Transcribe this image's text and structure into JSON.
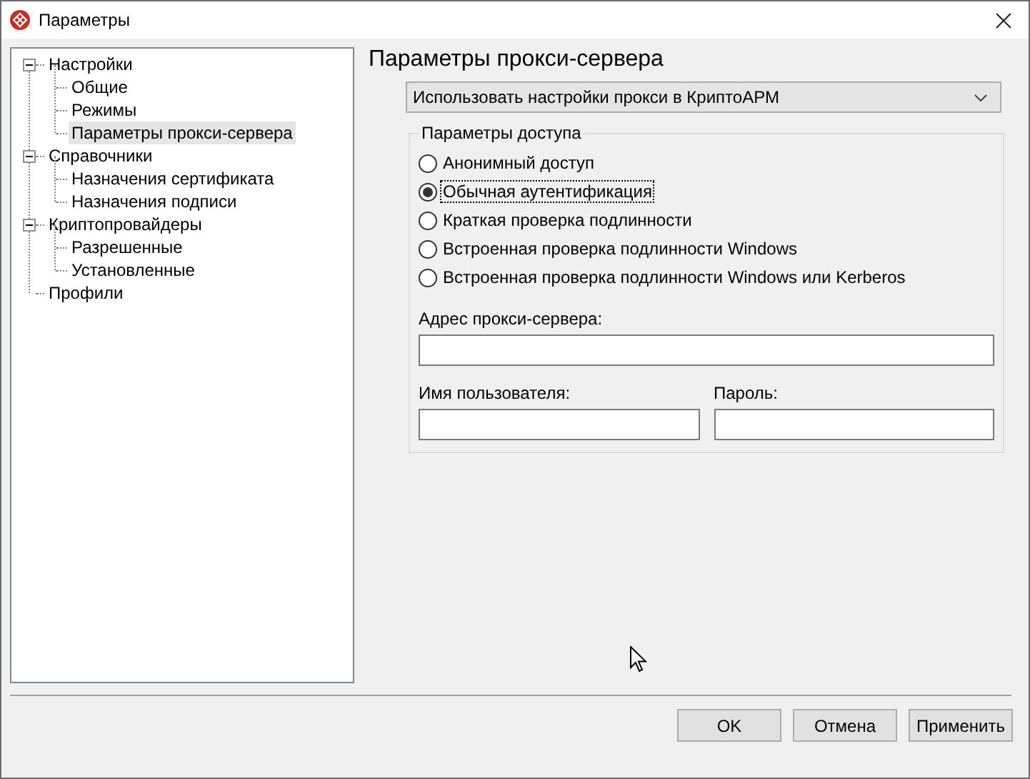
{
  "window": {
    "title": "Параметры"
  },
  "tree": [
    {
      "label": "Настройки",
      "expanded": true,
      "selected": false,
      "children": [
        {
          "label": "Общие",
          "selected": false
        },
        {
          "label": "Режимы",
          "selected": false
        },
        {
          "label": "Параметры прокси-сервера",
          "selected": true
        }
      ]
    },
    {
      "label": "Справочники",
      "expanded": true,
      "selected": false,
      "children": [
        {
          "label": "Назначения сертификата",
          "selected": false
        },
        {
          "label": "Назначения подписи",
          "selected": false
        }
      ]
    },
    {
      "label": "Криптопровайдеры",
      "expanded": true,
      "selected": false,
      "children": [
        {
          "label": "Разрешенные",
          "selected": false
        },
        {
          "label": "Установленные",
          "selected": false
        }
      ]
    },
    {
      "label": "Профили",
      "selected": false
    }
  ],
  "page_title": "Параметры прокси-сервера",
  "proxy_mode": {
    "value": "Использовать настройки прокси в КриптоАРМ"
  },
  "access_group": {
    "title": "Параметры доступа",
    "options": [
      {
        "label": "Анонимный доступ",
        "selected": false
      },
      {
        "label": "Обычная аутентификация",
        "selected": true
      },
      {
        "label": "Краткая проверка подлинности",
        "selected": false
      },
      {
        "label": "Встроенная проверка подлинности Windows",
        "selected": false
      },
      {
        "label": "Встроенная проверка подлинности Windows или Kerberos",
        "selected": false
      }
    ],
    "address": {
      "label": "Адрес прокси-сервера:"
    },
    "username": {
      "label": "Имя пользователя:"
    },
    "password": {
      "label": "Пароль:"
    }
  },
  "buttons": [
    "OK",
    "Отмена",
    "Применить"
  ]
}
